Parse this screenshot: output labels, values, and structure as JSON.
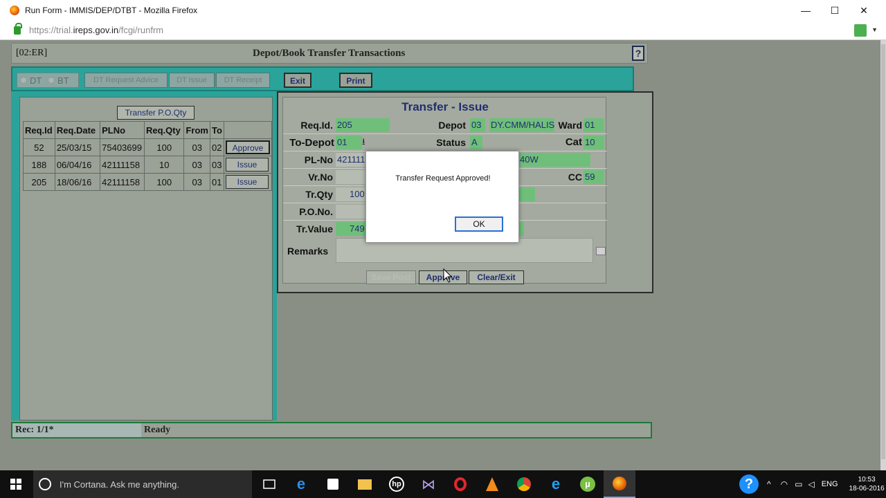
{
  "window": {
    "title": "Run Form - IMMIS/DEP/DTBT - Mozilla Firefox",
    "url_prefix": "https://trial.",
    "url_domain": "ireps.gov.in",
    "url_suffix": "/fcgi/runfrm",
    "controls": {
      "minimize": "—",
      "maximize": "☐",
      "close": "✕"
    }
  },
  "form": {
    "code": "[02:ER]",
    "title": "Depot/Book Transfer Transactions",
    "help": "?"
  },
  "toolbar": {
    "dt_label": "DT",
    "bt_label": "BT",
    "buttons": [
      {
        "label": "DT Request  Advice",
        "enabled": false
      },
      {
        "label": "DT Issue",
        "enabled": false
      },
      {
        "label": "DT Receipt",
        "enabled": false
      },
      {
        "label": "Exit",
        "enabled": true
      },
      {
        "label": "Print",
        "enabled": true
      }
    ]
  },
  "left_panel": {
    "transfer_po_qty": "Transfer P.O.Qty",
    "columns": [
      "Req.Id",
      "Req.Date",
      "PLNo",
      "Req.Qty",
      "From",
      "To",
      ""
    ],
    "rows": [
      {
        "req_id": "52",
        "req_date": "25/03/15",
        "plno": "75403699",
        "req_qty": "100",
        "from": "03",
        "to": "02",
        "action": "Approve"
      },
      {
        "req_id": "188",
        "req_date": "06/04/16",
        "plno": "42111158",
        "req_qty": "10",
        "from": "03",
        "to": "03",
        "action": "Issue"
      },
      {
        "req_id": "205",
        "req_date": "18/06/16",
        "plno": "42111158",
        "req_qty": "100",
        "from": "03",
        "to": "01",
        "action": "Issue"
      }
    ]
  },
  "right_panel": {
    "title": "Transfer - Issue",
    "labels": {
      "req_id": "Req.Id.",
      "depot": "Depot",
      "ward": "Ward",
      "to_depot": "To-Depot",
      "status": "Status",
      "cat": "Cat",
      "pl_no": "PL-No",
      "vr_no": "Vr.No",
      "cc": "CC",
      "tr_qty": "Tr.Qty",
      "po_no": "P.O.No.",
      "tr_value": "Tr.Value",
      "remarks": "Remarks"
    },
    "values": {
      "req_id": "205",
      "depot_code": "03",
      "depot_name": "DY.CMM/HALIS",
      "ward": "01",
      "to_depot": "01",
      "status": "A",
      "cat": "10",
      "pl_no": "421111",
      "pl_desc": "40W",
      "cc": "59",
      "tr_qty": "100",
      "tr_value": "749"
    },
    "buttons": [
      {
        "label": "Save Post",
        "enabled": false
      },
      {
        "label": "Approve",
        "enabled": true
      },
      {
        "label": "Clear/Exit",
        "enabled": true
      }
    ]
  },
  "status_bar": {
    "record": "Rec: 1/1*",
    "message": "Ready"
  },
  "dialog": {
    "message": "Transfer Request Approved!",
    "ok": "OK"
  },
  "taskbar": {
    "cortana_text": "I'm Cortana. Ask me anything.",
    "language": "ENG",
    "time": "10:53",
    "date": "18-06-2016"
  }
}
